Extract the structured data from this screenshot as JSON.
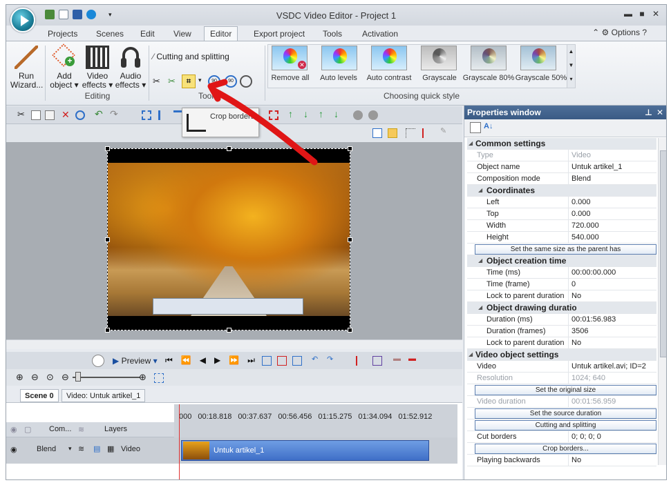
{
  "window": {
    "title": "VSDC Video Editor - Project 1",
    "min": "▬",
    "max": "■",
    "close": "✕"
  },
  "menu": {
    "tabs": [
      "Projects",
      "Scenes",
      "Edit",
      "View",
      "Editor",
      "Export project",
      "Tools",
      "Activation"
    ],
    "active": "Editor",
    "options": "Options"
  },
  "ribbon": {
    "run_wizard": "Run\nWizard...",
    "add_object": "Add\nobject ▾",
    "video_effects": "Video\neffects ▾",
    "audio_effects": "Audio\neffects ▾",
    "editing_label": "Editing",
    "tools_label": "Tools",
    "cutting_splitting": "Cutting and splitting",
    "quick_style_label": "Choosing quick style",
    "styles": [
      "Remove all",
      "Auto levels",
      "Auto contrast",
      "Grayscale",
      "Grayscale 80%",
      "Grayscale 50%"
    ]
  },
  "tooltip": {
    "crop": "Crop borders"
  },
  "timeline": {
    "scene_tab": "Scene 0",
    "video_tab": "Video: Untuk artikel_1",
    "preview": "Preview",
    "ruler": [
      "000",
      "00:18.818",
      "00:37.637",
      "00:56.456",
      "01:15.275",
      "01:34.094",
      "01:52.912"
    ],
    "layers_header": {
      "com": "Com...",
      "layers": "Layers"
    },
    "track": {
      "blend": "Blend",
      "video": "Video",
      "clip": "Untuk artikel_1"
    }
  },
  "properties": {
    "title": "Properties window",
    "rows": [
      {
        "t": "sec",
        "k": "Common settings"
      },
      {
        "t": "dim",
        "k": "Type",
        "v": "Video"
      },
      {
        "t": "row",
        "k": "Object name",
        "v": "Untuk artikel_1"
      },
      {
        "t": "row",
        "k": "Composition mode",
        "v": "Blend"
      },
      {
        "t": "sec2",
        "k": "Coordinates"
      },
      {
        "t": "sub",
        "k": "Left",
        "v": "0.000"
      },
      {
        "t": "sub",
        "k": "Top",
        "v": "0.000"
      },
      {
        "t": "sub",
        "k": "Width",
        "v": "720.000"
      },
      {
        "t": "sub",
        "k": "Height",
        "v": "540.000"
      },
      {
        "t": "btn",
        "k": "Set the same size as the parent has"
      },
      {
        "t": "sec2",
        "k": "Object creation time"
      },
      {
        "t": "sub",
        "k": "Time (ms)",
        "v": "00:00:00.000"
      },
      {
        "t": "sub",
        "k": "Time (frame)",
        "v": "0"
      },
      {
        "t": "sub",
        "k": "Lock to parent duration",
        "v": "No"
      },
      {
        "t": "sec2",
        "k": "Object drawing duration"
      },
      {
        "t": "sub",
        "k": "Duration (ms)",
        "v": "00:01:56.983"
      },
      {
        "t": "sub",
        "k": "Duration (frames)",
        "v": "3506"
      },
      {
        "t": "sub",
        "k": "Lock to parent duration",
        "v": "No"
      },
      {
        "t": "sec",
        "k": "Video object settings"
      },
      {
        "t": "row",
        "k": "Video",
        "v": "Untuk artikel.avi; ID=2"
      },
      {
        "t": "dim",
        "k": "Resolution",
        "v": "1024; 640"
      },
      {
        "t": "btn",
        "k": "Set the original size"
      },
      {
        "t": "dim",
        "k": "Video duration",
        "v": "00:01:56.959"
      },
      {
        "t": "btn",
        "k": "Set the source duration"
      },
      {
        "t": "btn",
        "k": "Cutting and splitting"
      },
      {
        "t": "row",
        "k": "Cut borders",
        "v": "0; 0; 0; 0"
      },
      {
        "t": "btn",
        "k": "Crop borders..."
      },
      {
        "t": "row",
        "k": "Playing backwards",
        "v": "No"
      }
    ]
  }
}
